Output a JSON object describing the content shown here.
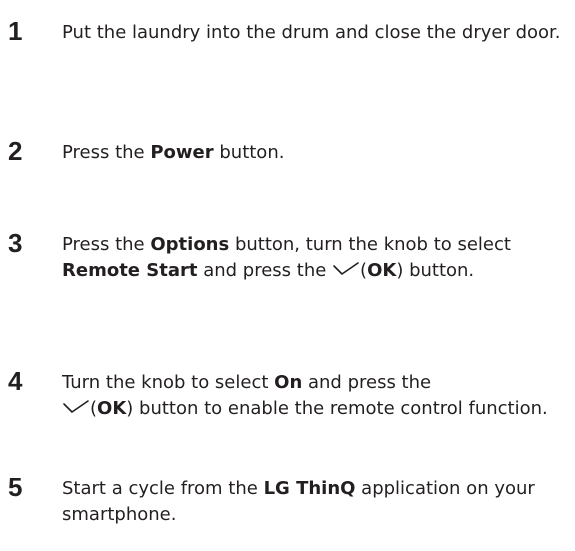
{
  "steps": [
    {
      "number": "1",
      "parts": [
        "Put the laundry into the drum and close the dryer door."
      ]
    },
    {
      "number": "2",
      "parts": [
        "Press the ",
        "Power",
        " button."
      ]
    },
    {
      "number": "3",
      "parts": [
        "Press the ",
        "Options",
        " button, turn the knob to select ",
        "Remote Start",
        " and press the ",
        "(",
        "OK",
        ")",
        " button."
      ]
    },
    {
      "number": "4",
      "parts": [
        "Turn the knob to select ",
        "On",
        " and press the ",
        "(",
        "OK",
        ")",
        " button to enable the remote control function."
      ]
    },
    {
      "number": "5",
      "parts": [
        "Start a cycle from the ",
        "LG ThinQ",
        " application on your smartphone."
      ]
    }
  ],
  "icons": {
    "check": "check-icon"
  },
  "colors": {
    "text": "#231f20"
  }
}
